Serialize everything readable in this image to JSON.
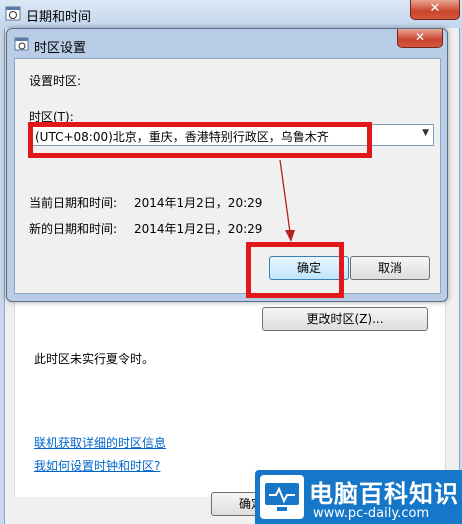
{
  "outer_window": {
    "title": "日期和时间",
    "close_label": "✕",
    "change_timezone_button": "更改时区(Z)...",
    "dst_notice": "此时区未实行夏令时。",
    "link_online_info": "联机获取详细的时区信息",
    "link_how_to": "我如何设置时钟和时区?",
    "ok_button_partial": "确定"
  },
  "dialog": {
    "title": "时区设置",
    "close_label": "✕",
    "set_timezone_heading": "设置时区:",
    "timezone_label": "时区(T):",
    "timezone_selected": "(UTC+08:00)北京，重庆，香港特别行政区，乌鲁木齐",
    "current_datetime_label": "当前日期和时间:",
    "current_datetime_value": "2014年1月2日，20:29",
    "new_datetime_label": "新的日期和时间:",
    "new_datetime_value": "2014年1月2日，20:29",
    "ok_button": "确定",
    "cancel_button": "取消"
  },
  "watermark": {
    "brand": "电脑百科知识",
    "url": "www.pc-daily.com"
  },
  "colors": {
    "annotation_red": "#e2171a",
    "link_blue": "#0066cc",
    "watermark_blue": "#1677c8"
  }
}
